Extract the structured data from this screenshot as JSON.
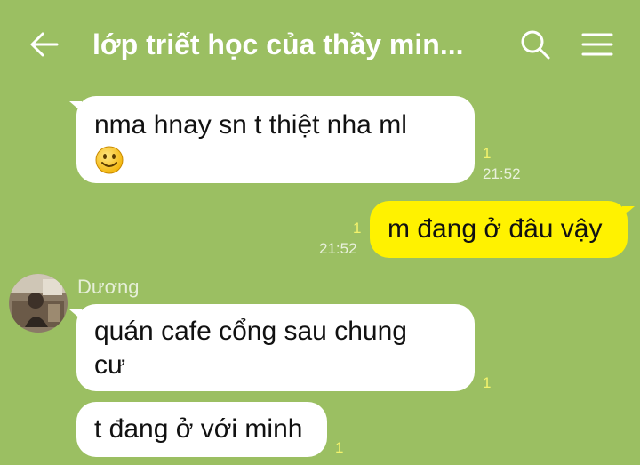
{
  "header": {
    "title": "lớp triết học của thầy min...",
    "back_icon": "arrow-left-icon",
    "search_icon": "search-icon",
    "menu_icon": "hamburger-menu-icon"
  },
  "colors": {
    "background": "#9bbf62",
    "incoming_bubble": "#ffffff",
    "outgoing_bubble": "#fff200",
    "read_count": "#f3f36c"
  },
  "messages": [
    {
      "direction": "incoming",
      "line1": "nma hnay sn t thiệt nha ml",
      "emoji": "smiley-emoji",
      "read": "1",
      "time": "21:52"
    },
    {
      "direction": "outgoing",
      "text": "m đang ở đâu vậy",
      "read": "1",
      "time": "21:52"
    },
    {
      "direction": "incoming",
      "sender": "Dương",
      "avatar": "photo-avatar",
      "line1": "quán cafe cổng sau chung",
      "line2": "cư",
      "read": "1"
    },
    {
      "direction": "incoming",
      "text": "t đang ở với minh",
      "read": "1"
    }
  ]
}
